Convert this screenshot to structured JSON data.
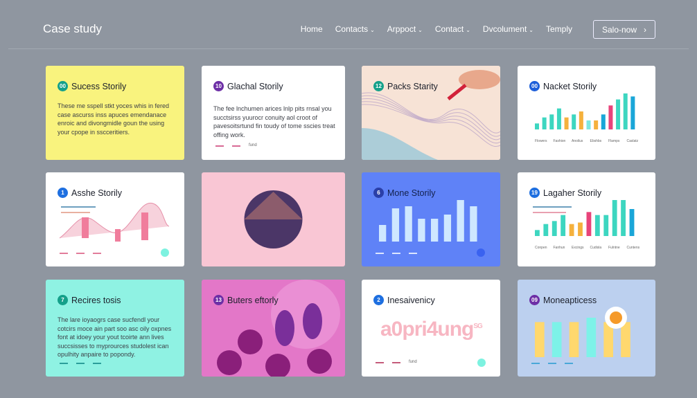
{
  "header": {
    "title": "Case study",
    "nav": [
      {
        "label": "Home",
        "dropdown": false
      },
      {
        "label": "Contacts",
        "dropdown": true
      },
      {
        "label": "Arppoct",
        "dropdown": true
      },
      {
        "label": "Contact",
        "dropdown": true
      },
      {
        "label": "Dvcolument",
        "dropdown": true
      },
      {
        "label": "Temply",
        "dropdown": false
      }
    ],
    "cta": "Salo-now",
    "cta_icon": "chevron-right-icon"
  },
  "cards": [
    {
      "badge": "00",
      "badge_color": "#14a08a",
      "title": "Sucess Storily",
      "bg": "#f9f37e",
      "text": "These me sspell stkt yoces whis in fered case ascurss inss apuces emendanace enroic and divongmidle goun the using your cpope in sscceritiers."
    },
    {
      "badge": "10",
      "badge_color": "#6d2fa6",
      "title": "Glachal Storily",
      "bg": "#ffffff",
      "text": "The fee lnchumen arices lnlp pits rnsal you succtsirss yuurocr conuity aol croot of pavesoitsrtund fin toudy of tome sscies treat offing work.",
      "footer": "fund"
    },
    {
      "badge": "12",
      "badge_color": "#14a08a",
      "title": "Packs Starity",
      "bg": "#f6dfd3"
    },
    {
      "badge": "00",
      "badge_color": "#1e5fd9",
      "title": "Nacket Storily",
      "bg": "#ffffff",
      "bars": [
        2,
        4,
        5,
        7,
        4,
        5,
        6,
        3,
        3,
        5,
        8,
        10,
        12,
        11
      ],
      "labels": [
        "Flowers",
        "Fashion",
        "Anoilus",
        "Ebshbs",
        "Flamps",
        "Caslatz"
      ]
    },
    {
      "badge": "1",
      "badge_color": "#1e6fe0",
      "title": "Asshe Storily",
      "bg": "#ffffff"
    },
    {
      "bg": "#f9c6d4"
    },
    {
      "badge": "6",
      "badge_color": "#2a3fa8",
      "title": "Mone Storily",
      "bg": "#5f82f7",
      "bars": [
        4,
        8,
        8.5,
        5.5,
        5.5,
        6.5,
        10,
        8.5
      ]
    },
    {
      "badge": "19",
      "badge_color": "#1e6fe0",
      "title": "Lagaher Storily",
      "bg": "#ffffff",
      "bars": [
        2,
        4,
        5,
        7,
        4,
        4.5,
        8,
        7,
        7,
        12,
        12,
        9
      ],
      "labels": [
        "Conpen",
        "Fanhun",
        "Excings",
        "Cudisla",
        "Fulntne",
        "Cuntens"
      ]
    },
    {
      "badge": "7",
      "badge_color": "#14a08a",
      "title": "Recires tosis",
      "bg": "#8ff2e3",
      "text": "The lare ioyaogrs case sucfendl your cotcirs moce ain part soo asc oily oxpnes font at idoey your yout tcoirte ann lives succsisses to myprources studolest ican opulhity anpaire to popondy."
    },
    {
      "badge": "13",
      "badge_color": "#6d2fa6",
      "title": "Buters eftorly",
      "bg": "#e377c8"
    },
    {
      "badge": "2",
      "badge_color": "#1e6fe0",
      "title": "Inesaivenicy",
      "bg": "#ffffff",
      "big": "a0pri4ung",
      "sup": "SG",
      "footer": "fund"
    },
    {
      "badge": "09",
      "badge_color": "#6d2fa6",
      "title": "Moneapticess",
      "bg": "#bcd0ef",
      "bars": [
        8,
        8,
        8,
        9,
        8,
        8
      ]
    }
  ]
}
